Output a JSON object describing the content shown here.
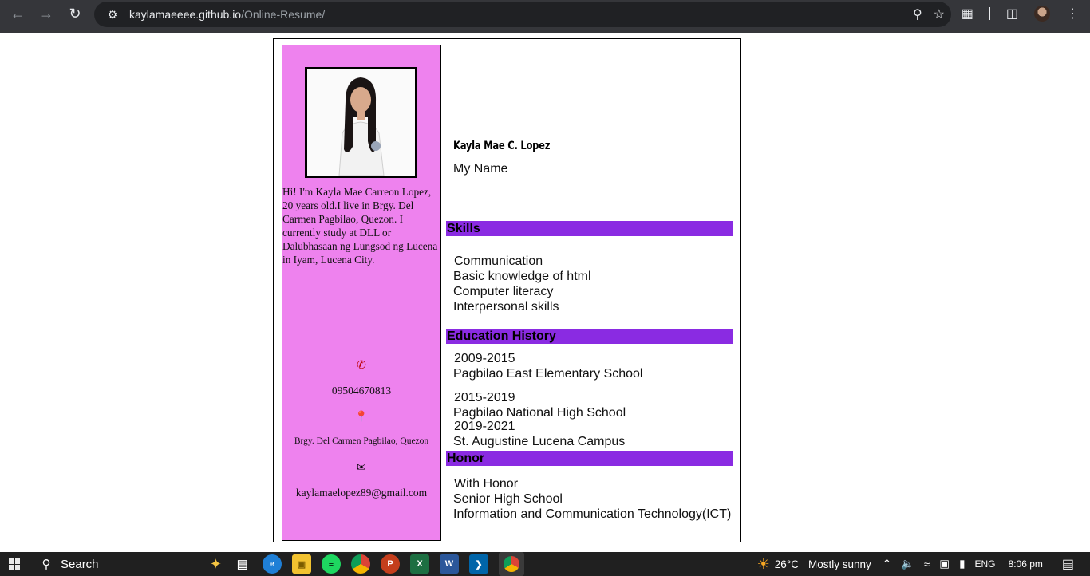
{
  "browser": {
    "url_host": "kaylamaeeee.github.io",
    "url_path": "/Online-Resume/"
  },
  "sidebar": {
    "bio": "Hi! I'm Kayla Mae Carreon Lopez, 20 years old.I live in Brgy. Del Carmen Pagbilao, Quezon. I currently study at DLL or Dalubhasaan ng Lungsod ng Lucena in Iyam, Lucena City.",
    "phone": "09504670813",
    "address": "Brgy. Del Carmen Pagbilao, Quezon",
    "email": "kaylamaelopez89@gmail.com"
  },
  "main": {
    "name": "Kayla Mae C. Lopez",
    "subname": "My Name",
    "skills_title": "Skills",
    "skills": [
      "Communication",
      "Basic knowledge of html",
      "Computer literacy",
      "Interpersonal skills"
    ],
    "education_title": "Education History",
    "education": [
      {
        "years": "2009-2015",
        "school": "Pagbilao East Elementary School"
      },
      {
        "years": "2015-2019",
        "school": "Pagbilao National High School"
      },
      {
        "years": "2019-2021",
        "school": "St. Augustine Lucena Campus"
      }
    ],
    "honor_title": "Honor",
    "honors": [
      "With Honor",
      "Senior High School",
      "Information and Communication Technology(ICT)"
    ]
  },
  "taskbar": {
    "search_label": "Search",
    "temperature": "26°C",
    "weather": "Mostly sunny",
    "language": "ENG",
    "time": "8:06 pm"
  },
  "colors": {
    "sidebar_bg": "#ee82ee",
    "section_bar": "#8a2be2"
  }
}
